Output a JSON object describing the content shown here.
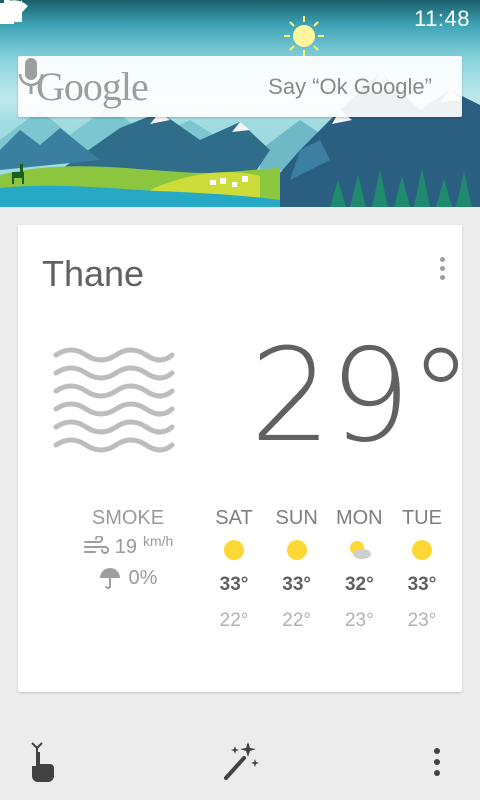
{
  "status_bar": {
    "time": "11:48"
  },
  "search": {
    "logo_text": "Google",
    "hint": "Say “Ok Google”"
  },
  "weather": {
    "city": "Thane",
    "temperature": "29°",
    "condition": "SMOKE",
    "wind_speed": "19",
    "wind_unit": "km/h",
    "precipitation": "0%",
    "forecast": [
      {
        "day": "SAT",
        "icon": "sunny-icon",
        "high": "33°",
        "low": "22°"
      },
      {
        "day": "SUN",
        "icon": "sunny-icon",
        "high": "33°",
        "low": "22°"
      },
      {
        "day": "MON",
        "icon": "partly-cloudy-icon",
        "high": "32°",
        "low": "23°"
      },
      {
        "day": "TUE",
        "icon": "sunny-icon",
        "high": "33°",
        "low": "23°"
      }
    ]
  },
  "colors": {
    "sun": "#fdd835",
    "card_text": "#616161",
    "muted_text": "#9e9e9e"
  }
}
